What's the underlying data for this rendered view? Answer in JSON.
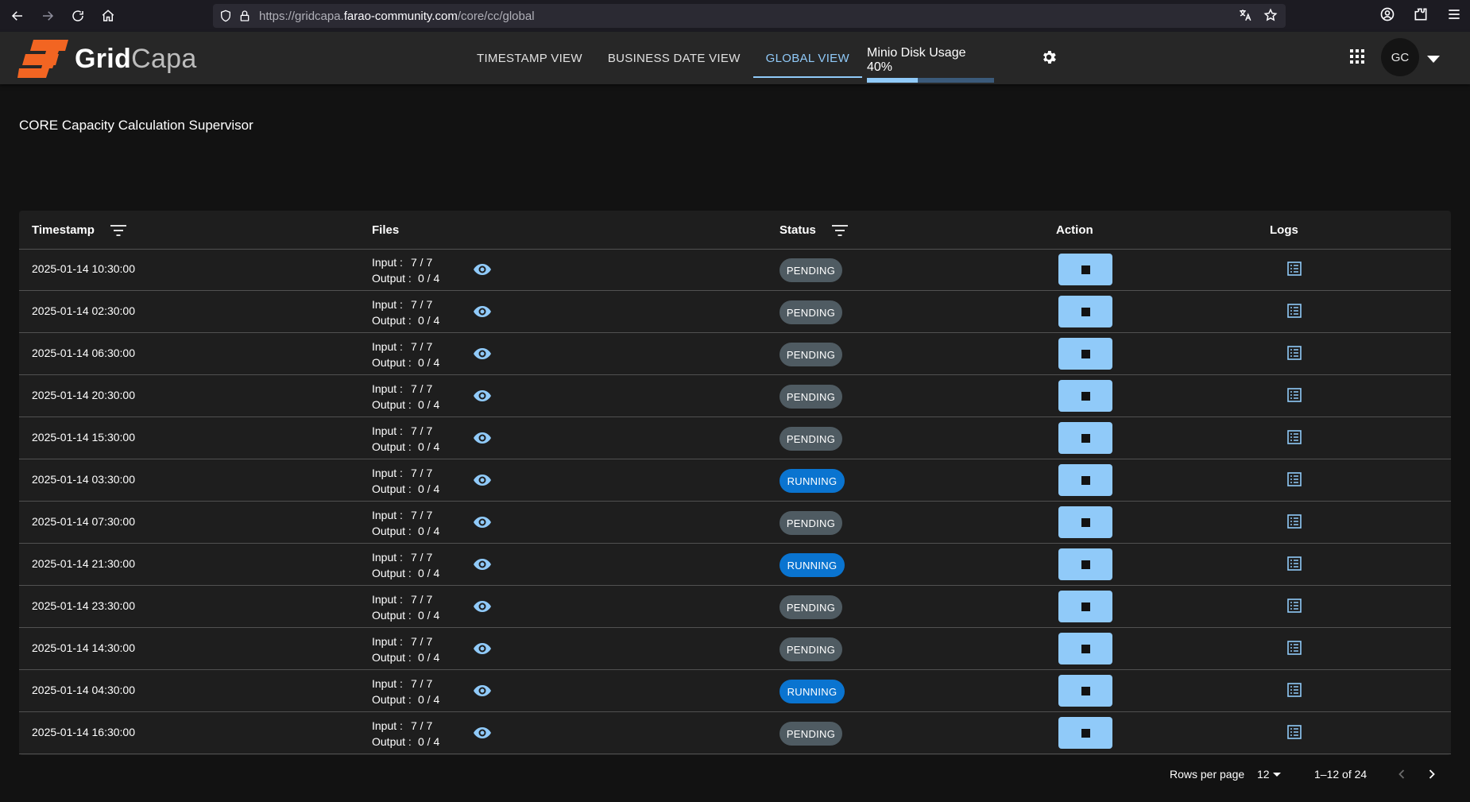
{
  "browser": {
    "url_prefix": "https://gridcapa.",
    "url_host": "farao-community.com",
    "url_path": "/core/cc/global"
  },
  "header": {
    "logo_bold": "Grid",
    "logo_light": "Capa",
    "tabs": [
      {
        "label": "TIMESTAMP VIEW"
      },
      {
        "label": "BUSINESS DATE VIEW"
      },
      {
        "label": "GLOBAL VIEW",
        "active": true
      }
    ],
    "disk_usage_label": "Minio Disk Usage 40%",
    "disk_usage_fraction": 0.4,
    "avatar_initials": "GC"
  },
  "page_title": "CORE Capacity Calculation Supervisor",
  "table": {
    "columns": {
      "timestamp": "Timestamp",
      "files": "Files",
      "status": "Status",
      "action": "Action",
      "logs": "Logs"
    },
    "input_label": "Input :",
    "output_label": "Output :",
    "rows": [
      {
        "timestamp": "2025-01-14 10:30:00",
        "input": "7 / 7",
        "output": "0 / 4",
        "status": "PENDING"
      },
      {
        "timestamp": "2025-01-14 02:30:00",
        "input": "7 / 7",
        "output": "0 / 4",
        "status": "PENDING"
      },
      {
        "timestamp": "2025-01-14 06:30:00",
        "input": "7 / 7",
        "output": "0 / 4",
        "status": "PENDING"
      },
      {
        "timestamp": "2025-01-14 20:30:00",
        "input": "7 / 7",
        "output": "0 / 4",
        "status": "PENDING"
      },
      {
        "timestamp": "2025-01-14 15:30:00",
        "input": "7 / 7",
        "output": "0 / 4",
        "status": "PENDING"
      },
      {
        "timestamp": "2025-01-14 03:30:00",
        "input": "7 / 7",
        "output": "0 / 4",
        "status": "RUNNING"
      },
      {
        "timestamp": "2025-01-14 07:30:00",
        "input": "7 / 7",
        "output": "0 / 4",
        "status": "PENDING"
      },
      {
        "timestamp": "2025-01-14 21:30:00",
        "input": "7 / 7",
        "output": "0 / 4",
        "status": "RUNNING"
      },
      {
        "timestamp": "2025-01-14 23:30:00",
        "input": "7 / 7",
        "output": "0 / 4",
        "status": "PENDING"
      },
      {
        "timestamp": "2025-01-14 14:30:00",
        "input": "7 / 7",
        "output": "0 / 4",
        "status": "PENDING"
      },
      {
        "timestamp": "2025-01-14 04:30:00",
        "input": "7 / 7",
        "output": "0 / 4",
        "status": "RUNNING"
      },
      {
        "timestamp": "2025-01-14 16:30:00",
        "input": "7 / 7",
        "output": "0 / 4",
        "status": "PENDING"
      }
    ]
  },
  "pagination": {
    "rows_per_page_label": "Rows per page",
    "rows_per_page_value": "12",
    "range_label": "1–12 of 24"
  },
  "colors": {
    "accent": "#90caf9",
    "pending": "#4f5b62",
    "running": "#0a74d0",
    "logo_orange": "#f26522"
  }
}
